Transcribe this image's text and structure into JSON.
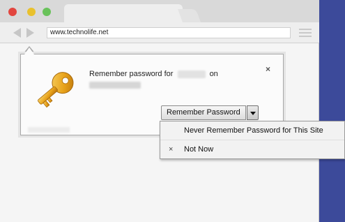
{
  "browser": {
    "url": "www.technolife.net"
  },
  "popup": {
    "prompt_prefix": "Remember password for",
    "prompt_on": "on",
    "close_label": "×",
    "remember_button": "Remember Password"
  },
  "menu": {
    "items": [
      {
        "label": "Never Remember Password for This Site"
      },
      {
        "label": "Not Now",
        "icon": "×"
      }
    ]
  },
  "colors": {
    "desktop": "#3c4a9a",
    "close_red": "#e2463f",
    "minimize_yellow": "#e9c12d",
    "zoom_green": "#69c25a",
    "key_gold": "#e8a21a"
  },
  "icons": [
    "back-arrow-icon",
    "forward-arrow-icon",
    "menu-icon",
    "key-icon",
    "chevron-down-icon",
    "close-icon"
  ]
}
